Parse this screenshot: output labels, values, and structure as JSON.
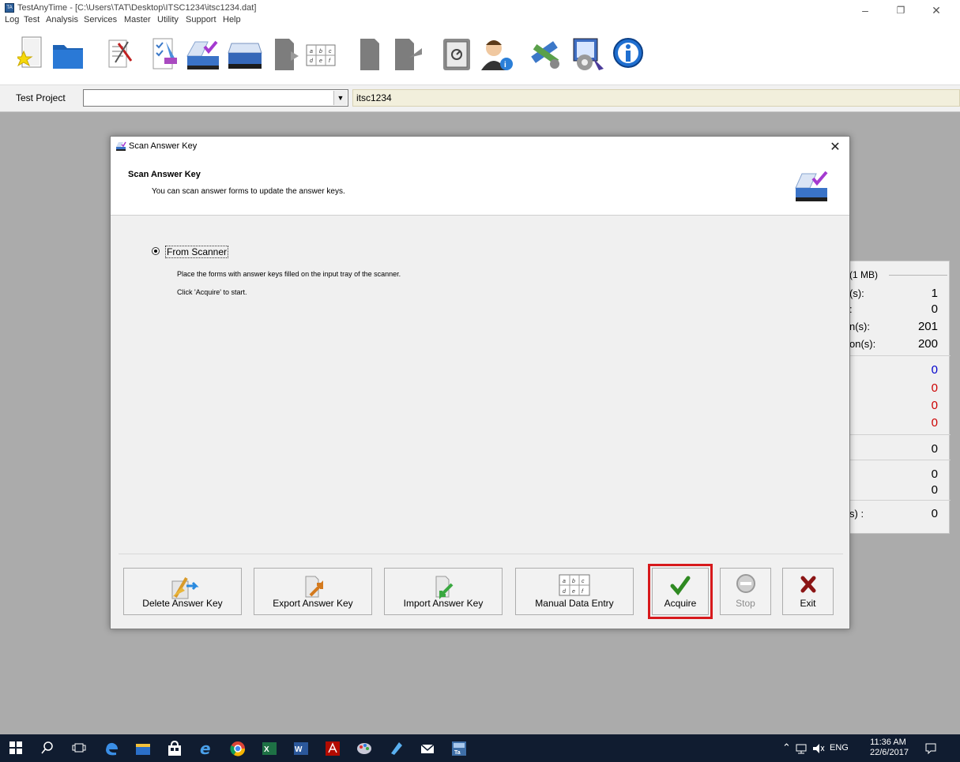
{
  "window": {
    "title": "TestAnyTime - [C:\\Users\\TAT\\Desktop\\ITSC1234\\itsc1234.dat]",
    "app_icon_text": "TA"
  },
  "menu": [
    "Log",
    "Test",
    "Analysis",
    "Services",
    "Master",
    "Utility",
    "Support",
    "Help"
  ],
  "toolbar": {
    "icons": [
      "new-project-icon",
      "open-folder-icon",
      "test-design-icon",
      "answer-key-icon",
      "scan-answer-key-icon",
      "scanner-icon",
      "document-icon",
      "manual-entry-icon",
      "document-icon",
      "export-icon",
      "safe-icon",
      "user-info-icon",
      "tools-icon",
      "settings-icon",
      "about-icon"
    ],
    "manual_entry_grid": [
      "a",
      "b",
      "c",
      "d",
      "e",
      "f"
    ]
  },
  "project": {
    "label": "Test Project",
    "combo_value": "",
    "name": "itsc1234"
  },
  "stats_panel": {
    "header": "(1 MB)",
    "rows": [
      {
        "label": "(s):",
        "value": "1",
        "color": "#000000"
      },
      {
        "label": ":",
        "value": "0",
        "color": "#000000"
      },
      {
        "label": "n(s):",
        "value": "201",
        "color": "#000000"
      },
      {
        "label": "on(s):",
        "value": "200",
        "color": "#000000"
      },
      {
        "label": "",
        "value": "0",
        "color": "#0000cc"
      },
      {
        "label": "",
        "value": "0",
        "color": "#cc0000"
      },
      {
        "label": "",
        "value": "0",
        "color": "#cc0000"
      },
      {
        "label": "",
        "value": "0",
        "color": "#cc0000"
      },
      {
        "label": "",
        "value": "0",
        "color": "#000000"
      },
      {
        "label": "",
        "value": "0",
        "color": "#000000"
      },
      {
        "label": "",
        "value": "0",
        "color": "#000000"
      },
      {
        "label": "s) :",
        "value": "0",
        "color": "#000000"
      }
    ]
  },
  "dialog": {
    "title": "Scan Answer Key",
    "heading": "Scan Answer Key",
    "subheading": "You can scan answer forms to update the answer keys.",
    "option_label": "From Scanner",
    "option_selected": true,
    "instructions": [
      "Place the forms with answer keys filled on the input tray of the scanner.",
      "Click 'Acquire' to start."
    ],
    "buttons": {
      "delete": "Delete Answer Key",
      "export": "Export Answer Key",
      "import": "Import Answer Key",
      "manual": "Manual Data Entry",
      "acquire": "Acquire",
      "stop": "Stop",
      "exit": "Exit"
    }
  },
  "taskbar": {
    "apps": [
      "start-icon",
      "search-icon",
      "task-view-icon",
      "edge-icon",
      "file-explorer-icon",
      "store-icon",
      "internet-explorer-icon",
      "chrome-icon",
      "excel-icon",
      "word-icon",
      "acrobat-icon",
      "paint-icon",
      "notes-icon",
      "mail-icon",
      "testanytime-icon"
    ],
    "language": "ENG",
    "time": "11:36 AM",
    "date": "22/6/2017"
  },
  "colors": {
    "accent_highlight": "#d7191c",
    "taskbar": "#101c30",
    "workspace": "#ababab"
  }
}
